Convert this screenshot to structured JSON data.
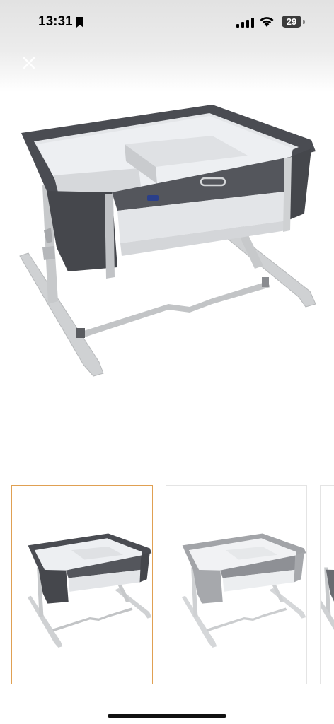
{
  "status_bar": {
    "time": "13:31",
    "battery": "29"
  },
  "icons": {
    "close": "close-icon",
    "bookmark": "bookmark-icon",
    "signal": "cellular-signal-icon",
    "wifi": "wifi-icon"
  },
  "gallery": {
    "selected_index": 0,
    "thumbnails": [
      {
        "variant": "dark-grey"
      },
      {
        "variant": "light-grey"
      },
      {
        "variant": "partial"
      }
    ],
    "selected_border_color": "#e0a052"
  },
  "colors": {
    "frame_dark": "#4a4c52",
    "frame_mid": "#8d8f94",
    "mesh": "#e9ebee",
    "leg": "#c9cbcd"
  }
}
